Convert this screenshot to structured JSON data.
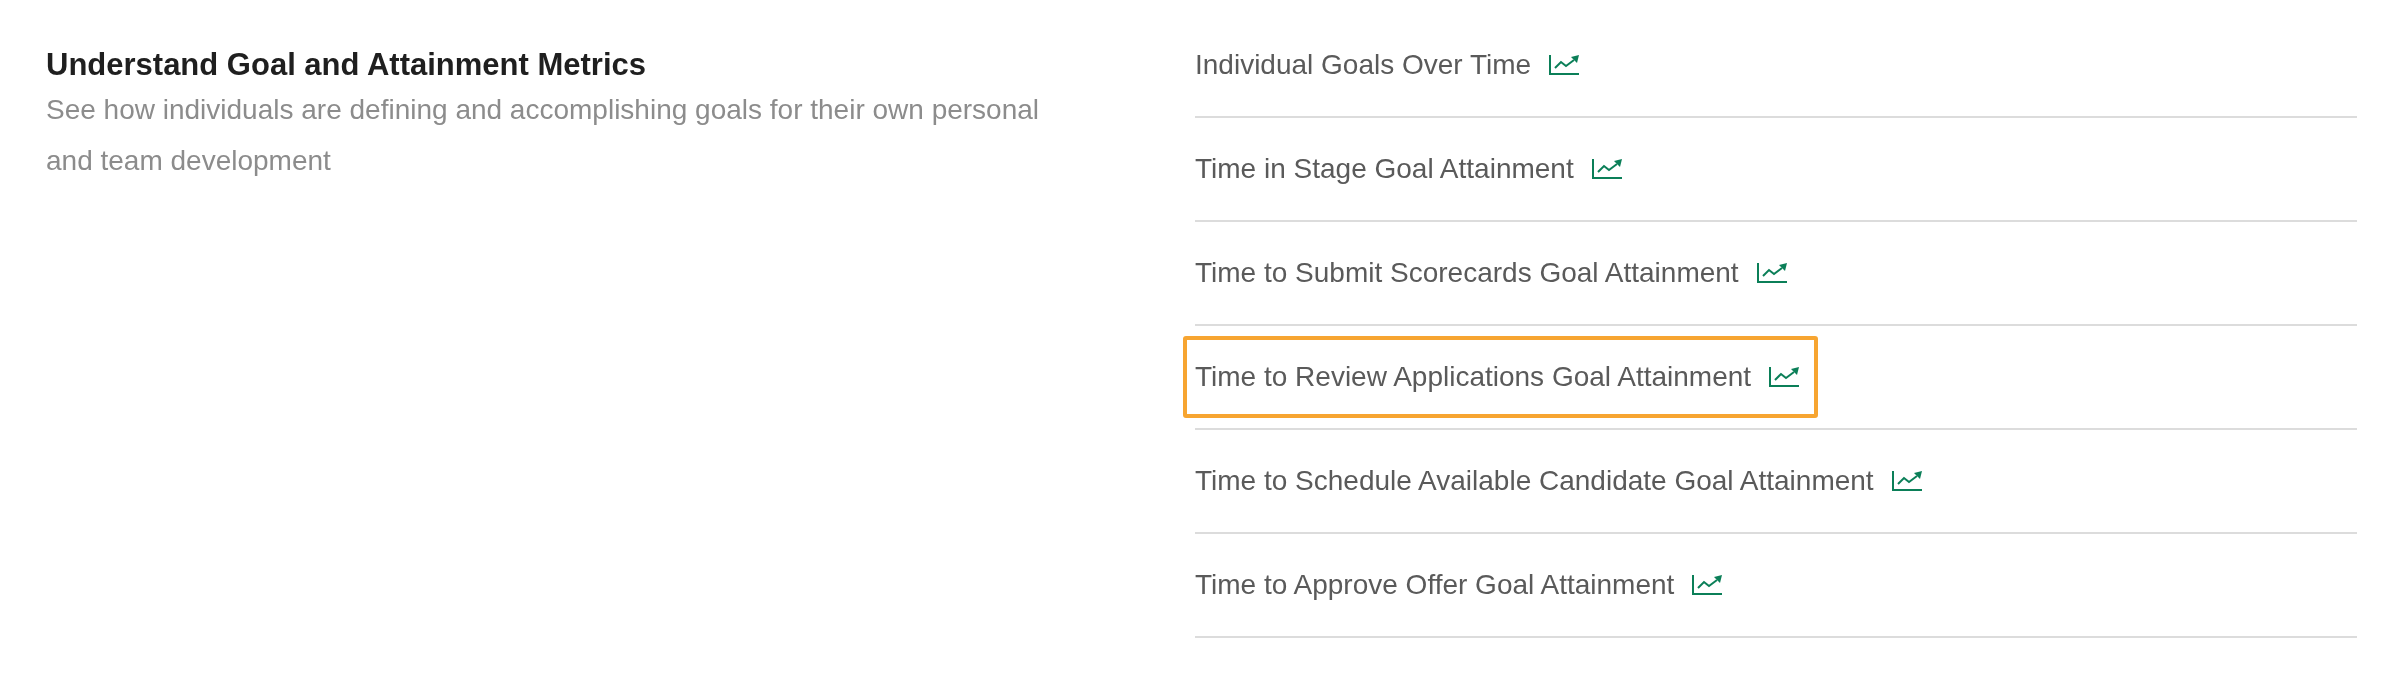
{
  "section": {
    "title": "Understand Goal and Attainment Metrics",
    "description": "See how individuals are defining and accomplishing goals for their own personal and team development"
  },
  "reports": [
    {
      "label": "Individual Goals Over Time",
      "highlighted": false
    },
    {
      "label": "Time in Stage Goal Attainment",
      "highlighted": false
    },
    {
      "label": "Time to Submit Scorecards Goal Attainment",
      "highlighted": false
    },
    {
      "label": "Time to Review Applications Goal Attainment",
      "highlighted": true
    },
    {
      "label": "Time to Schedule Available Candidate Goal Attainment",
      "highlighted": false
    },
    {
      "label": "Time to Approve Offer Goal Attainment",
      "highlighted": false
    }
  ]
}
